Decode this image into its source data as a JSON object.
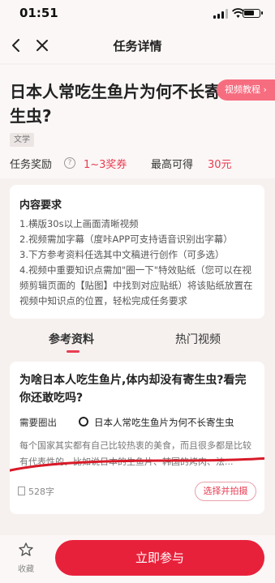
{
  "status_bar": {
    "time": "01:51"
  },
  "nav": {
    "title": "任务详情"
  },
  "task": {
    "title": "日本人常吃生鱼片为何不长寄生虫?",
    "tutorial_label": "视频教程 ›",
    "tag": "文学",
    "reward_label": "任务奖励",
    "reward_value": "1~3奖券",
    "max_label": "最高可得",
    "max_value": "30元"
  },
  "requirements": {
    "title": "内容要求",
    "items": [
      "1.横版30s以上画面清晰视频",
      "2.视频需加字幕（度咔APP可支持语音识别出字幕）",
      "3.下方参考资料任选其中文稿进行创作（可多选）",
      "4.视频中重要知识点需加\"圈一下\"特效贴纸（您可以在视频剪辑页面的【贴图】中找到对应贴纸）将该贴纸放置在视频中知识点的位置，轻松完成任务要求"
    ]
  },
  "tabs": [
    {
      "label": "参考资料",
      "active": true
    },
    {
      "label": "热门视频",
      "active": false
    }
  ],
  "article": {
    "title": "为啥日本人吃生鱼片,体内却没有寄生虫?看完你还敢吃吗?",
    "required_label": "需要圈出",
    "required_value": "日本人常吃生鱼片为何不长寄生虫",
    "body": "每个国家其实都有自己比较热衷的美食，而且很多都是比较有代表性的，比如说日本的生鱼片、韩国的烤肉、法...",
    "word_count": "528字",
    "select_label": "选择并拍摄"
  },
  "bottom": {
    "favorite_label": "收藏",
    "join_label": "立即参与"
  },
  "colors": {
    "accent": "#e83c52",
    "primary_button": "#e8213b",
    "tutorial_button": "#f76d80",
    "annotation_line": "#d81a28"
  }
}
